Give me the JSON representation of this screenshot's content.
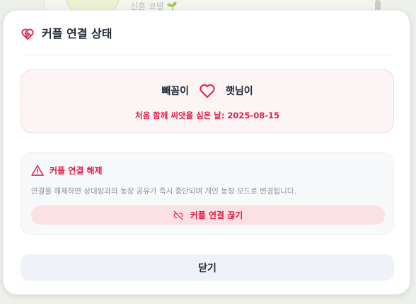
{
  "background": {
    "peek_label": "신혼 코발 🌱"
  },
  "modal": {
    "title": "커플 연결 상태",
    "header_icon": "heart-handshake-icon"
  },
  "couple": {
    "partner_a": "빼꼼이",
    "partner_b": "햇님이",
    "heart_icon": "heart-icon",
    "start_line": "처음 함께 씨앗을 심은 날: 2025-08-15"
  },
  "disconnect": {
    "title": "커플 연결 해제",
    "description": "연결을 해제하면 상대방과의 농장 공유가 즉시 중단되며 개인 농장 모드로 변경됩니다.",
    "button_label": "커플 연결 끊기",
    "warning_icon": "warning-triangle-icon",
    "unlink_icon": "unlink-icon"
  },
  "footer": {
    "close_label": "닫기"
  },
  "colors": {
    "accent": "#e11d48",
    "danger_bg": "#fbe1e3",
    "card_pink_bg": "#fdf5f5",
    "card_pink_border": "#fbd5d8",
    "neutral_btn_bg": "#eff2f7",
    "text_primary": "#1f2937",
    "text_muted": "#8b919c"
  }
}
